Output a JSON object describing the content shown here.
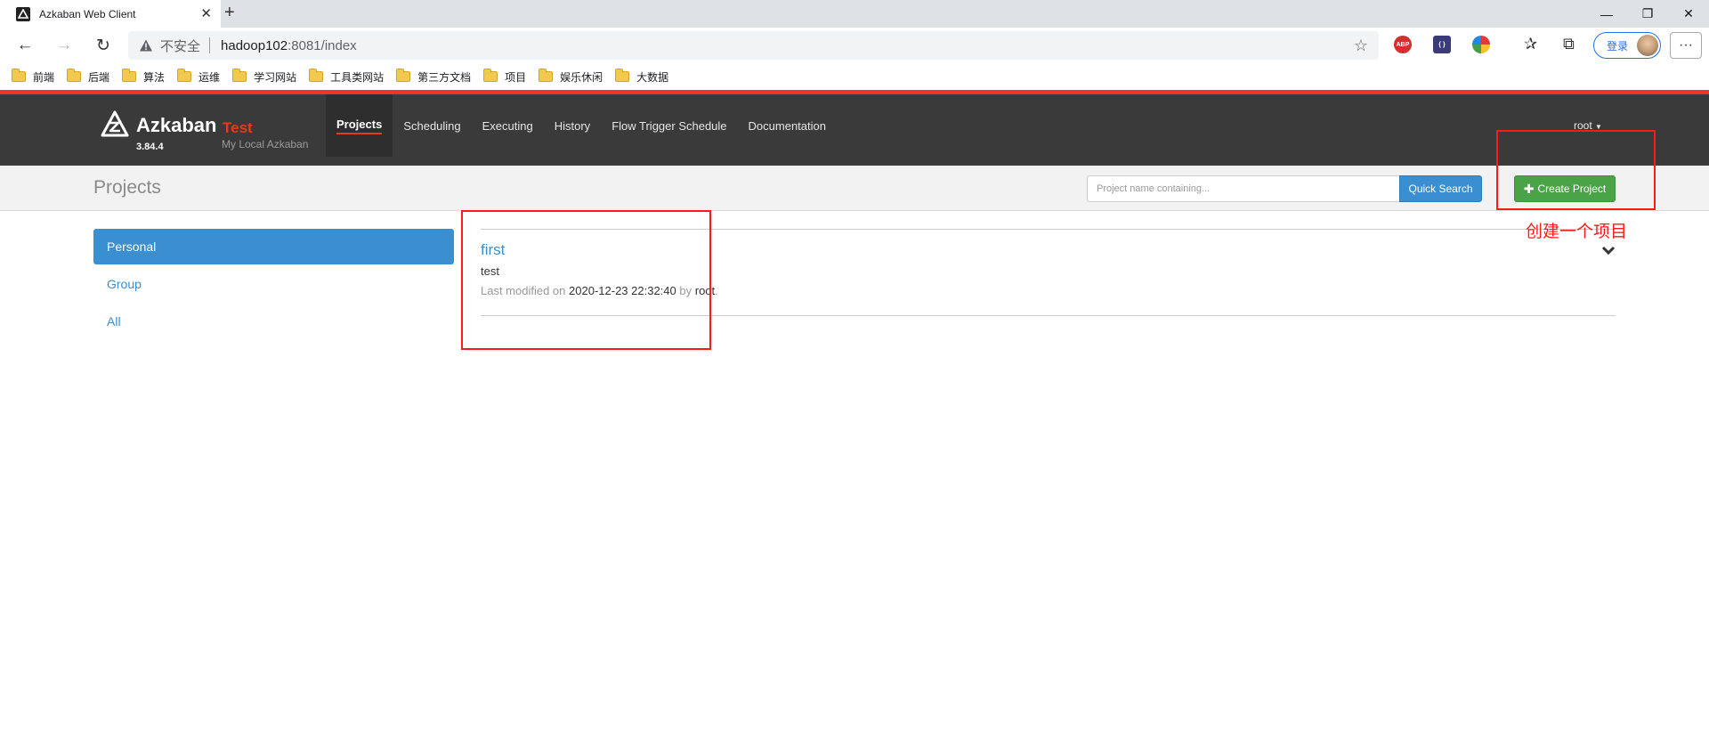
{
  "browser": {
    "tab_title": "Azkaban Web Client",
    "new_tab_symbol": "+",
    "close_symbol": "✕",
    "security_label": "不安全",
    "url_host": "hadoop102",
    "url_rest": ":8081/index",
    "extension_abp": "ABP",
    "login_label": "登录",
    "menu_symbol": "···",
    "bookmarks": [
      "前端",
      "后端",
      "算法",
      "运维",
      "学习网站",
      "工具类网站",
      "第三方文档",
      "项目",
      "娱乐休闲",
      "大数据"
    ]
  },
  "brand": {
    "name": "Azkaban",
    "env": "Test",
    "version": "3.84.4",
    "subtitle": "My Local Azkaban"
  },
  "nav": {
    "items": [
      "Projects",
      "Scheduling",
      "Executing",
      "History",
      "Flow Trigger Schedule",
      "Documentation"
    ],
    "active": "Projects",
    "user": "root"
  },
  "subheader": {
    "title": "Projects",
    "search_placeholder": "Project name containing...",
    "quick_search_label": "Quick Search",
    "create_project_label": "Create Project"
  },
  "sidebar": {
    "items": [
      "Personal",
      "Group",
      "All"
    ],
    "active": "Personal"
  },
  "projects": [
    {
      "name": "first",
      "description": "test",
      "modified_prefix": "Last modified on",
      "modified_time": "2020-12-23 22:32:40",
      "by_label": "by",
      "modified_by": "root",
      "end_mark": "."
    }
  ],
  "annotation": {
    "label": "创建一个项目",
    "color": "#ff1a1a"
  },
  "colors": {
    "accent_red": "#e8391a",
    "primary_blue": "#3a8fd0",
    "success_green": "#4aa447",
    "topbar": "#3a3a3a"
  }
}
